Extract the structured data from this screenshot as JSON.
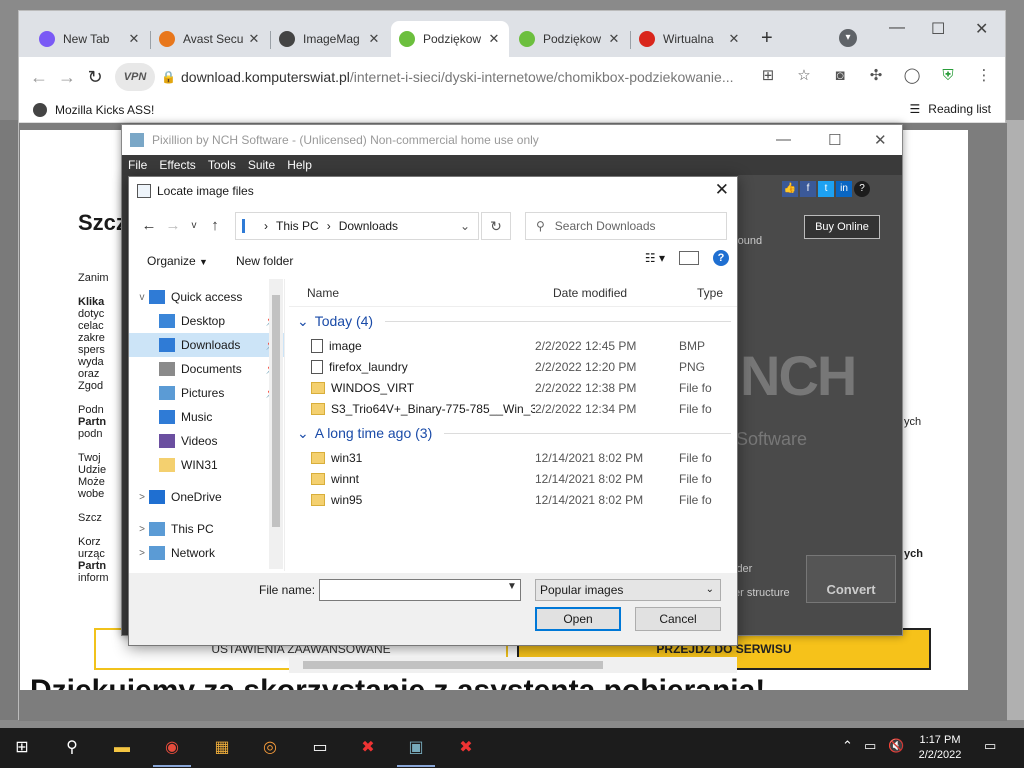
{
  "browser": {
    "tabs": [
      {
        "label": "New Tab",
        "active": false,
        "favicon_color": "#7a5af5"
      },
      {
        "label": "Avast Secu",
        "active": false,
        "favicon_color": "#e8771c"
      },
      {
        "label": "ImageMag",
        "active": false,
        "favicon_color": "#444"
      },
      {
        "label": "Podziękow",
        "active": true,
        "favicon_color": "#6cbf3e"
      },
      {
        "label": "Podziękow",
        "active": false,
        "favicon_color": "#6cbf3e"
      },
      {
        "label": "Wirtualna",
        "active": false,
        "favicon_color": "#d9261c"
      }
    ],
    "new_tab_symbol": "+",
    "url_host": "download.komputerswiat.pl",
    "url_path": "/internet-i-sieci/dyski-internetowe/chomikbox-podziekowanie...",
    "vpn_label": "VPN",
    "bookmark_label": "Mozilla Kicks ASS!",
    "reading_list_label": "Reading list"
  },
  "webpage": {
    "heading": "Dziękujemy za skorzystanie z asystenta pobierania!",
    "big_text": "Szcz",
    "btn_left": "USTAWIENIA ZAAWANSOWANE",
    "btn_right": "PRZEJDŹ DO SERWISU",
    "frag_zanim": "Zanim",
    "frag_klik": "Klika",
    "frag_lines1": [
      "dotyc",
      "celac",
      "zakre",
      "spers",
      "wyda",
      "oraz",
      "Zgod"
    ],
    "frag_podn": "Podn",
    "frag_partn": "Partn",
    "frag_podn2": "podn",
    "frag_twoj": [
      "Twoj",
      "Udzie",
      "Może",
      "wobe"
    ],
    "frag_szcz": "Szcz",
    "frag_korz": [
      "Korz",
      "urząc"
    ],
    "frag_partn2": "Partn",
    "frag_inform": "inform",
    "frag_right_ch": "ych",
    "frag_right_ch2": "ych"
  },
  "pixillion": {
    "title": "Pixillion by NCH Software - (Unlicensed) Non-commercial home use only",
    "menu": [
      "File",
      "Effects",
      "Tools",
      "Suite",
      "Help"
    ],
    "buy_label": "Buy Online",
    "background_frag": "round",
    "nch_logo": "NCH",
    "nch_software": "Software",
    "folder_frag": "lder",
    "structure_frag": "er structure",
    "convert_label": "Convert"
  },
  "dialog": {
    "title": "Locate image files",
    "breadcrumb": [
      "This PC",
      "Downloads"
    ],
    "search_placeholder": "Search Downloads",
    "organize_label": "Organize",
    "new_folder_label": "New folder",
    "nav_items": [
      {
        "label": "Quick access",
        "level": 0,
        "chev": "v",
        "pinned": false,
        "selected": false,
        "icon_color": "#2f7bd6"
      },
      {
        "label": "Desktop",
        "level": 1,
        "chev": "",
        "pinned": true,
        "selected": false,
        "icon_color": "#3b86d8"
      },
      {
        "label": "Downloads",
        "level": 1,
        "chev": "",
        "pinned": true,
        "selected": true,
        "icon_color": "#2f7bd6"
      },
      {
        "label": "Documents",
        "level": 1,
        "chev": "",
        "pinned": true,
        "selected": false,
        "icon_color": "#8a8a8a"
      },
      {
        "label": "Pictures",
        "level": 1,
        "chev": "",
        "pinned": true,
        "selected": false,
        "icon_color": "#5b9bd5"
      },
      {
        "label": "Music",
        "level": 1,
        "chev": "",
        "pinned": false,
        "selected": false,
        "icon_color": "#2f7bd6"
      },
      {
        "label": "Videos",
        "level": 1,
        "chev": "",
        "pinned": false,
        "selected": false,
        "icon_color": "#6b4fa0"
      },
      {
        "label": "WIN31",
        "level": 1,
        "chev": "",
        "pinned": false,
        "selected": false,
        "icon_color": "#f4d06f"
      },
      {
        "label": "OneDrive",
        "level": 0,
        "chev": ">",
        "pinned": false,
        "selected": false,
        "icon_color": "#1f6fd1"
      },
      {
        "label": "This PC",
        "level": 0,
        "chev": ">",
        "pinned": false,
        "selected": false,
        "icon_color": "#5b9bd5"
      },
      {
        "label": "Network",
        "level": 0,
        "chev": ">",
        "pinned": false,
        "selected": false,
        "icon_color": "#5b9bd5"
      }
    ],
    "columns": {
      "name": "Name",
      "date": "Date modified",
      "type": "Type"
    },
    "groups": [
      {
        "label": "Today (4)",
        "files": [
          {
            "name": "image",
            "date": "2/2/2022 12:45 PM",
            "type": "BMP",
            "kind": "file"
          },
          {
            "name": "firefox_laundry",
            "date": "2/2/2022 12:20 PM",
            "type": "PNG",
            "kind": "file"
          },
          {
            "name": "WINDOS_VIRT",
            "date": "2/2/2022 12:38 PM",
            "type": "File fo",
            "kind": "folder"
          },
          {
            "name": "S3_Trio64V+_Binary-775-785__Win_3.1_En...",
            "date": "2/2/2022 12:34 PM",
            "type": "File fo",
            "kind": "folder"
          }
        ]
      },
      {
        "label": "A long time ago (3)",
        "files": [
          {
            "name": "win31",
            "date": "12/14/2021 8:02 PM",
            "type": "File fo",
            "kind": "folder"
          },
          {
            "name": "winnt",
            "date": "12/14/2021 8:02 PM",
            "type": "File fo",
            "kind": "folder"
          },
          {
            "name": "win95",
            "date": "12/14/2021 8:02 PM",
            "type": "File fo",
            "kind": "folder"
          }
        ]
      }
    ],
    "file_name_label": "File name:",
    "file_name_value": "",
    "file_type_value": "Popular images",
    "open_label": "Open",
    "cancel_label": "Cancel"
  },
  "taskbar": {
    "time": "1:17 PM",
    "date": "2/2/2022"
  }
}
